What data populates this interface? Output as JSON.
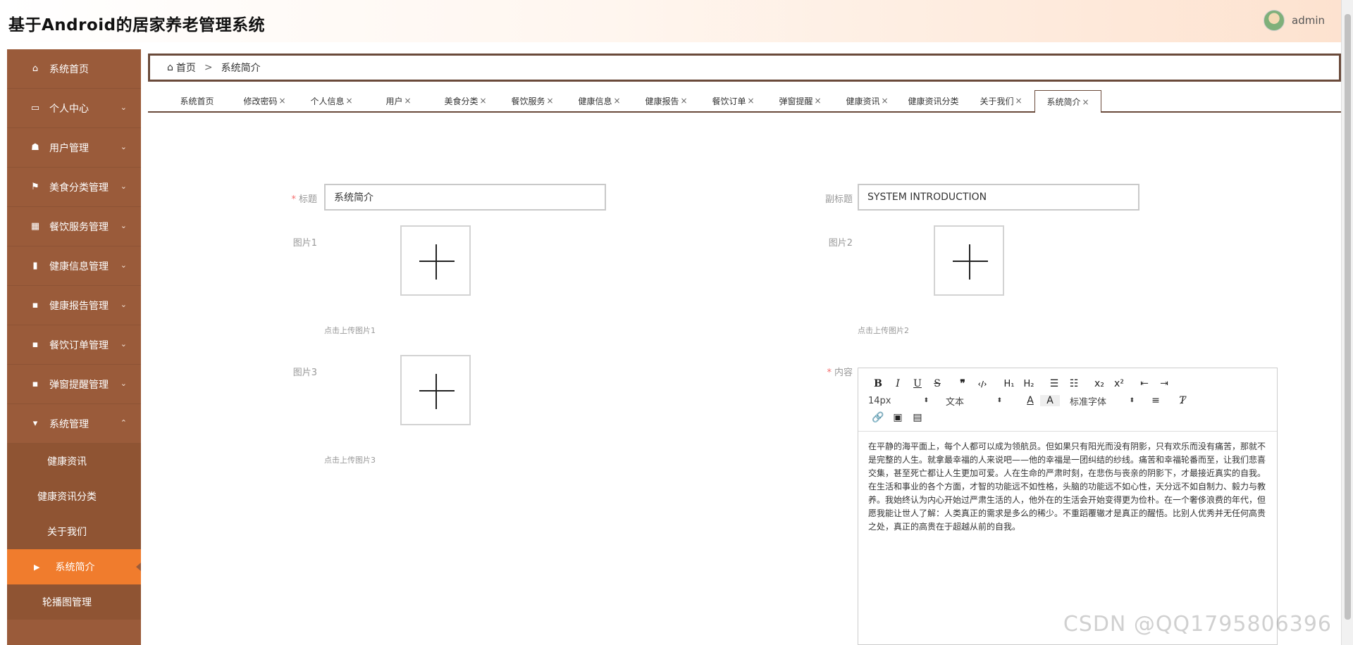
{
  "header": {
    "title": "基于Android的居家养老管理系统",
    "username": "admin"
  },
  "sidebar": {
    "items": [
      {
        "label": "系统首页",
        "icon": "home-icon",
        "glyph": "⌂",
        "chevron": ""
      },
      {
        "label": "个人中心",
        "icon": "id-card-icon",
        "glyph": "▭",
        "chevron": "⌄"
      },
      {
        "label": "用户管理",
        "icon": "thumb-icon",
        "glyph": "☗",
        "chevron": "⌄"
      },
      {
        "label": "美食分类管理",
        "icon": "flag-icon",
        "glyph": "⚑",
        "chevron": "⌄"
      },
      {
        "label": "餐饮服务管理",
        "icon": "grid-icon",
        "glyph": "▦",
        "chevron": "⌄"
      },
      {
        "label": "健康信息管理",
        "icon": "book-icon",
        "glyph": "▮",
        "chevron": "⌄"
      },
      {
        "label": "健康报告管理",
        "icon": "apps-icon",
        "glyph": "▪",
        "chevron": "⌄"
      },
      {
        "label": "餐饮订单管理",
        "icon": "apps-icon",
        "glyph": "▪",
        "chevron": "⌄"
      },
      {
        "label": "弹窗提醒管理",
        "icon": "apps-icon",
        "glyph": "▪",
        "chevron": "⌄"
      },
      {
        "label": "系统管理",
        "icon": "monitor-icon",
        "glyph": "▾",
        "chevron": "⌃"
      }
    ],
    "sub_items": [
      {
        "label": "健康资讯"
      },
      {
        "label": "健康资讯分类"
      },
      {
        "label": "关于我们"
      },
      {
        "label": "系统简介",
        "active": true
      },
      {
        "label": "轮播图管理"
      }
    ]
  },
  "breadcrumb": {
    "home": "首页",
    "separator": ">",
    "current": "系统简介"
  },
  "tabs": [
    {
      "label": "系统首页",
      "closable": ""
    },
    {
      "label": "修改密码",
      "closable": "×"
    },
    {
      "label": "个人信息",
      "closable": "×"
    },
    {
      "label": "用户",
      "closable": "×"
    },
    {
      "label": "美食分类",
      "closable": "×"
    },
    {
      "label": "餐饮服务",
      "closable": "×"
    },
    {
      "label": "健康信息",
      "closable": "×"
    },
    {
      "label": "健康报告",
      "closable": "×"
    },
    {
      "label": "餐饮订单",
      "closable": "×"
    },
    {
      "label": "弹窗提醒",
      "closable": "×"
    },
    {
      "label": "健康资讯",
      "closable": "×"
    },
    {
      "label": "健康资讯分类",
      "closable": ""
    },
    {
      "label": "关于我们",
      "closable": "×"
    },
    {
      "label": "系统简介",
      "closable": "×",
      "active": true
    }
  ],
  "form": {
    "title_label": "标题",
    "title_value": "系统简介",
    "subtitle_label": "副标题",
    "subtitle_value": "SYSTEM INTRODUCTION",
    "image1_label": "图片1",
    "image1_hint": "点击上传图片1",
    "image2_label": "图片2",
    "image2_hint": "点击上传图片2",
    "image3_label": "图片3",
    "image3_hint": "点击上传图片3",
    "content_label": "内容",
    "required_mark": "*"
  },
  "editor": {
    "font_size": "14px",
    "header_select": "文本",
    "font_family": "标准字体",
    "content": "在平静的海平面上，每个人都可以成为领航员。但如果只有阳光而没有阴影，只有欢乐而没有痛苦，那就不是完整的人生。就拿最幸福的人来说吧——他的幸福是一团纠结的纱线。痛苦和幸福轮番而至，让我们悲喜交集，甚至死亡都让人生更加可爱。人在生命的严肃时刻，在悲伤与丧亲的阴影下，才最接近真实的自我。在生活和事业的各个方面，才智的功能远不如性格，头脑的功能远不如心性，天分远不如自制力、毅力与教养。我始终认为内心开始过严肃生活的人，他外在的生活会开始变得更为俭朴。在一个奢侈浪费的年代，但愿我能让世人了解：人类真正的需求是多么的稀少。不重蹈覆辙才是真正的醒悟。比别人优秀并无任何高贵之处，真正的高贵在于超越从前的自我。"
  },
  "watermark": "CSDN @QQ1795806396",
  "colors": {
    "sidebar": "#9a5b3a",
    "active": "#f07c2d",
    "border": "#6a4a3a"
  }
}
